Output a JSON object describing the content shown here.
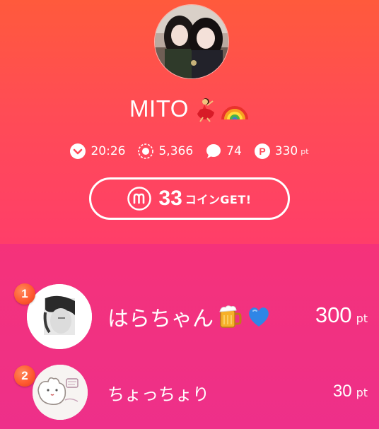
{
  "profile": {
    "name": "MITO",
    "name_emojis": [
      "dancer-emoji",
      "rainbow-emoji"
    ]
  },
  "stats": {
    "time": "20:26",
    "views": "5,366",
    "comments": "74",
    "points": "330",
    "points_unit": "pt"
  },
  "coin_button": {
    "count": "33",
    "suffix": "コインGET!"
  },
  "ranking": [
    {
      "rank": "1",
      "name": "はらちゃん",
      "points": "300",
      "unit": "pt",
      "emojis": [
        "beer-emoji",
        "blue-heart-emoji"
      ]
    },
    {
      "rank": "2",
      "name": "ちょっちょり",
      "points": "30",
      "unit": "pt",
      "emojis": []
    }
  ],
  "colors": {
    "header_top": "#ff5a3c",
    "header_bottom": "#ff3e69",
    "ranking_bg": "#f03183",
    "badge": "#ff5a30"
  }
}
